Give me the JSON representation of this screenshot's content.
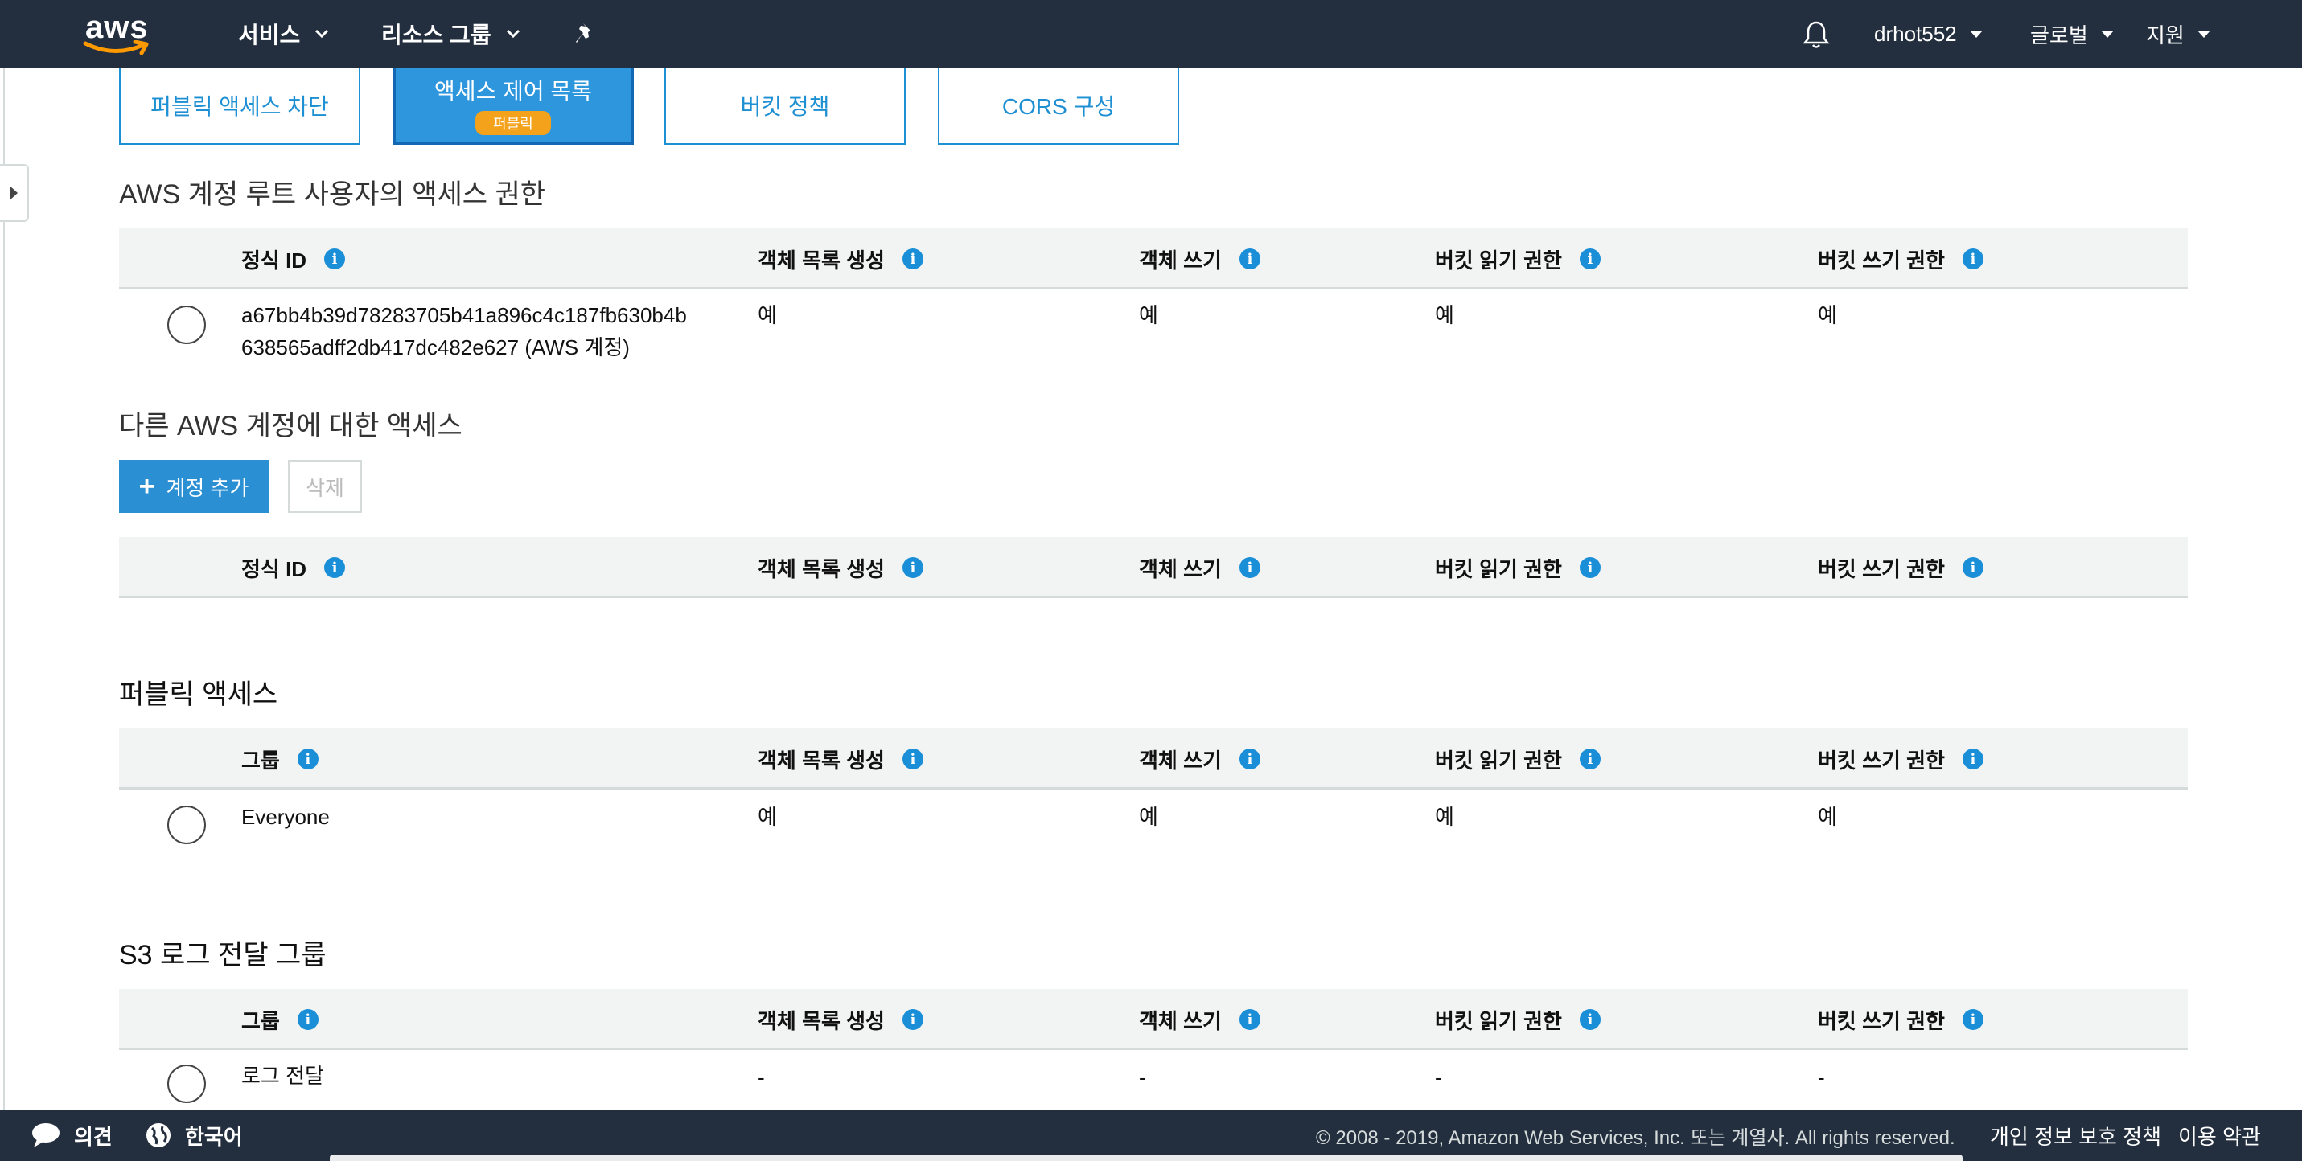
{
  "nav": {
    "logo": "aws",
    "services": "서비스",
    "resource_groups": "리소스 그룹",
    "user": "drhot552",
    "region": "글로벌",
    "support": "지원"
  },
  "tabs": [
    {
      "label": "퍼블릭 액세스 차단"
    },
    {
      "label": "액세스 제어 목록",
      "badge": "퍼블릭"
    },
    {
      "label": "버킷 정책"
    },
    {
      "label": "CORS 구성"
    }
  ],
  "columns": {
    "canonical_id": "정식 ID",
    "group": "그룹",
    "list_objects": "객체 목록 생성",
    "write_objects": "객체 쓰기",
    "read_bucket_perm": "버킷 읽기 권한",
    "write_bucket_perm": "버킷 쓰기 권한"
  },
  "sections": {
    "root": {
      "title": "AWS 계정 루트 사용자의 액세스 권한",
      "row": {
        "id_line1": "a67bb4b39d78283705b41a896c4c187fb630b4b",
        "id_line2": "638565adff2db417dc482e627 (AWS 계정)",
        "list_objects": "예",
        "write_objects": "예",
        "read_bucket_perm": "예",
        "write_bucket_perm": "예"
      }
    },
    "other": {
      "title": "다른 AWS 계정에 대한 액세스",
      "add_button": "계정 추가",
      "delete_button": "삭제"
    },
    "public": {
      "title": "퍼블릭 액세스",
      "row": {
        "group": "Everyone",
        "list_objects": "예",
        "write_objects": "예",
        "read_bucket_perm": "예",
        "write_bucket_perm": "예"
      }
    },
    "s3log": {
      "title": "S3 로그 전달 그룹",
      "row": {
        "group": "로그 전달",
        "list_objects": "-",
        "write_objects": "-",
        "read_bucket_perm": "-",
        "write_bucket_perm": "-"
      }
    }
  },
  "footer": {
    "feedback": "의견",
    "language": "한국어",
    "copyright": "© 2008 - 2019, Amazon Web Services, Inc. 또는 계열사. All rights reserved.",
    "privacy": "개인 정보 보호 정책",
    "terms": "이용 약관"
  },
  "colors": {
    "nav_bg": "#232f3e",
    "accent": "#1d8fd3",
    "badge": "#f4a21c"
  }
}
